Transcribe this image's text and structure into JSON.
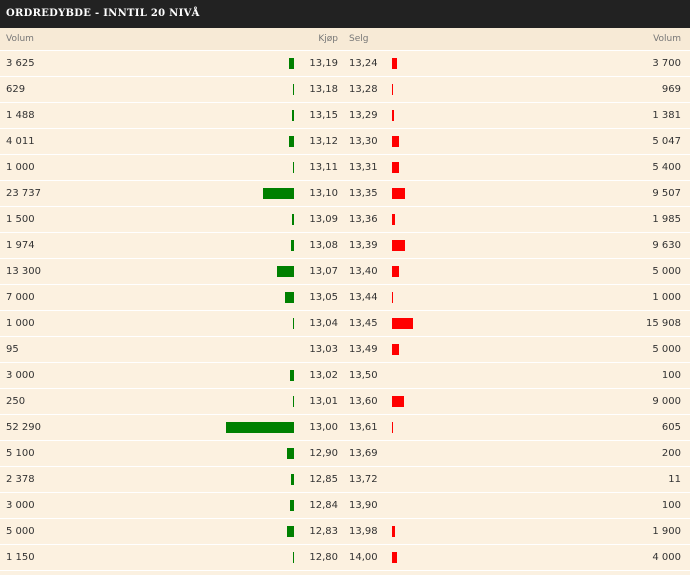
{
  "title": "ORDREDYBDE - INNTIL 20 NIVÅ",
  "columns": {
    "bid_volume": "Volum",
    "bid_price": "Kjøp",
    "ask_price": "Selg",
    "ask_volume": "Volum"
  },
  "colors": {
    "buy_bar": "#008000",
    "sell_bar": "#ff0000",
    "title_bg": "#222222",
    "row_bg": "#fcf1e0"
  },
  "rows": [
    {
      "bid_volume": "3 625",
      "bid_price": "13,19",
      "ask_price": "13,24",
      "ask_volume": "3 700",
      "bid_qty": 3625,
      "ask_qty": 3700
    },
    {
      "bid_volume": "629",
      "bid_price": "13,18",
      "ask_price": "13,28",
      "ask_volume": "969",
      "bid_qty": 629,
      "ask_qty": 969
    },
    {
      "bid_volume": "1 488",
      "bid_price": "13,15",
      "ask_price": "13,29",
      "ask_volume": "1 381",
      "bid_qty": 1488,
      "ask_qty": 1381
    },
    {
      "bid_volume": "4 011",
      "bid_price": "13,12",
      "ask_price": "13,30",
      "ask_volume": "5 047",
      "bid_qty": 4011,
      "ask_qty": 5047
    },
    {
      "bid_volume": "1 000",
      "bid_price": "13,11",
      "ask_price": "13,31",
      "ask_volume": "5 400",
      "bid_qty": 1000,
      "ask_qty": 5400
    },
    {
      "bid_volume": "23 737",
      "bid_price": "13,10",
      "ask_price": "13,35",
      "ask_volume": "9 507",
      "bid_qty": 23737,
      "ask_qty": 9507
    },
    {
      "bid_volume": "1 500",
      "bid_price": "13,09",
      "ask_price": "13,36",
      "ask_volume": "1 985",
      "bid_qty": 1500,
      "ask_qty": 1985
    },
    {
      "bid_volume": "1 974",
      "bid_price": "13,08",
      "ask_price": "13,39",
      "ask_volume": "9 630",
      "bid_qty": 1974,
      "ask_qty": 9630
    },
    {
      "bid_volume": "13 300",
      "bid_price": "13,07",
      "ask_price": "13,40",
      "ask_volume": "5 000",
      "bid_qty": 13300,
      "ask_qty": 5000
    },
    {
      "bid_volume": "7 000",
      "bid_price": "13,05",
      "ask_price": "13,44",
      "ask_volume": "1 000",
      "bid_qty": 7000,
      "ask_qty": 1000
    },
    {
      "bid_volume": "1 000",
      "bid_price": "13,04",
      "ask_price": "13,45",
      "ask_volume": "15 908",
      "bid_qty": 1000,
      "ask_qty": 15908
    },
    {
      "bid_volume": "95",
      "bid_price": "13,03",
      "ask_price": "13,49",
      "ask_volume": "5 000",
      "bid_qty": 95,
      "ask_qty": 5000
    },
    {
      "bid_volume": "3 000",
      "bid_price": "13,02",
      "ask_price": "13,50",
      "ask_volume": "100",
      "bid_qty": 3000,
      "ask_qty": 100
    },
    {
      "bid_volume": "250",
      "bid_price": "13,01",
      "ask_price": "13,60",
      "ask_volume": "9 000",
      "bid_qty": 250,
      "ask_qty": 9000
    },
    {
      "bid_volume": "52 290",
      "bid_price": "13,00",
      "ask_price": "13,61",
      "ask_volume": "605",
      "bid_qty": 52290,
      "ask_qty": 605
    },
    {
      "bid_volume": "5 100",
      "bid_price": "12,90",
      "ask_price": "13,69",
      "ask_volume": "200",
      "bid_qty": 5100,
      "ask_qty": 200
    },
    {
      "bid_volume": "2 378",
      "bid_price": "12,85",
      "ask_price": "13,72",
      "ask_volume": "11",
      "bid_qty": 2378,
      "ask_qty": 11
    },
    {
      "bid_volume": "3 000",
      "bid_price": "12,84",
      "ask_price": "13,90",
      "ask_volume": "100",
      "bid_qty": 3000,
      "ask_qty": 100
    },
    {
      "bid_volume": "5 000",
      "bid_price": "12,83",
      "ask_price": "13,98",
      "ask_volume": "1 900",
      "bid_qty": 5000,
      "ask_qty": 1900
    },
    {
      "bid_volume": "1 150",
      "bid_price": "12,80",
      "ask_price": "14,00",
      "ask_volume": "4 000",
      "bid_qty": 1150,
      "ask_qty": 4000
    }
  ]
}
